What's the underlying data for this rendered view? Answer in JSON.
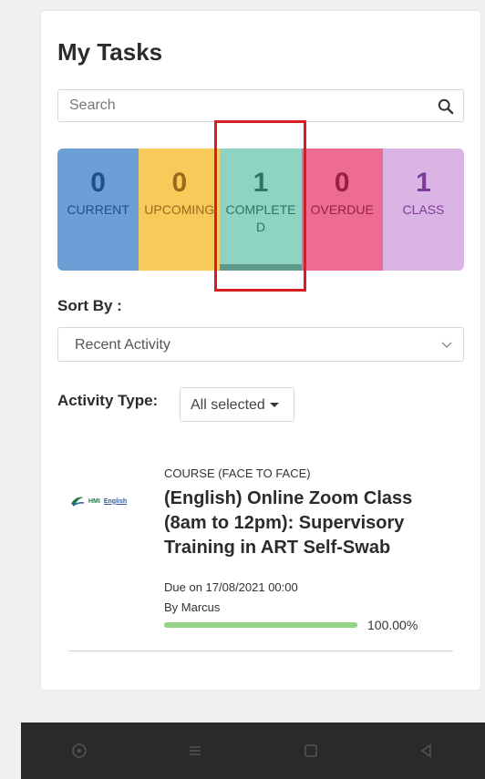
{
  "page_title": "My Tasks",
  "search": {
    "placeholder": "Search"
  },
  "tiles": [
    {
      "key": "current",
      "count": "0",
      "label": "CURRENT",
      "color": "#6c9fd6"
    },
    {
      "key": "upcoming",
      "count": "0",
      "label": "UPCOMING",
      "color": "#f8ca5a"
    },
    {
      "key": "completed",
      "count": "1",
      "label": "COMPLETED",
      "color": "#8fd3c3",
      "selected": true
    },
    {
      "key": "overdue",
      "count": "0",
      "label": "OVERDUE",
      "color": "#ee6c92"
    },
    {
      "key": "class",
      "count": "1",
      "label": "CLASS",
      "color": "#dab4e5"
    }
  ],
  "sort": {
    "label": "Sort By :",
    "value": "Recent Activity"
  },
  "activity_type": {
    "label": "Activity Type:",
    "value": "All selected"
  },
  "task": {
    "type": "COURSE (FACE TO FACE)",
    "title": "(English) Online Zoom Class (8am to 12pm): Supervisory Training in ART Self-Swab",
    "logo_text_1": "HMI",
    "logo_text_2": "English",
    "due": "Due on 17/08/2021 00:00",
    "by": "By Marcus",
    "progress": 1.0,
    "progress_label": "100.00%"
  },
  "colors": {
    "highlight": "#d81e1e",
    "progress": "#93d386"
  },
  "icons": {
    "search": "search-icon",
    "chevron": "chevron-down-icon",
    "nav": [
      "circle-icon",
      "menu-icon",
      "square-icon",
      "back-icon"
    ]
  }
}
